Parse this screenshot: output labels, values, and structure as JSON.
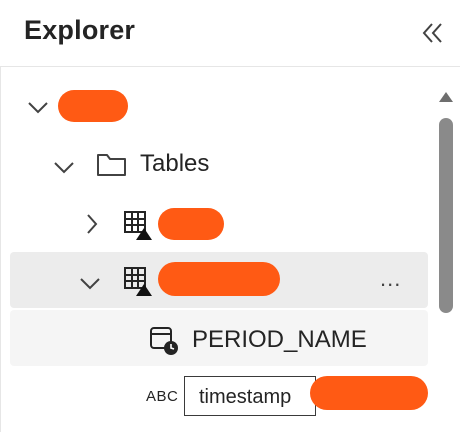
{
  "panel": {
    "title": "Explorer"
  },
  "tree": {
    "folder_label": "Tables",
    "column_label": "PERIOD_NAME",
    "more_label": "...",
    "type_label": "ABC",
    "field_value": "timestamp"
  },
  "colors": {
    "redaction": "#ff5a14",
    "selected_row": "#ececec",
    "scroll_thumb": "#8a8a8a"
  },
  "icons": {
    "collapse": "double-chevron-left-icon",
    "expand": "chevron-down-icon",
    "collapsed": "chevron-right-icon",
    "folder": "folder-icon",
    "table": "table-icon",
    "column": "calendar-clock-icon"
  }
}
